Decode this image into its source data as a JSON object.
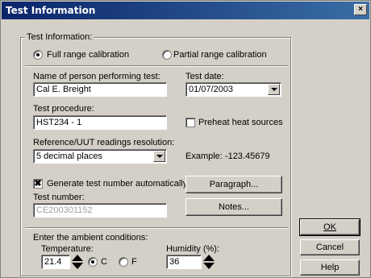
{
  "window": {
    "title": "Test Information",
    "close_glyph": "×"
  },
  "group": {
    "legend": "Test Information:"
  },
  "calibration": {
    "full_label": "Full range calibration",
    "partial_label": "Partial range calibration",
    "selected": "full"
  },
  "person": {
    "label": "Name of person performing test:",
    "value": "Cal E. Breight"
  },
  "test_date": {
    "label": "Test date:",
    "value": "01/07/2003"
  },
  "procedure": {
    "label": "Test procedure:",
    "value": "HST234 - 1"
  },
  "preheat": {
    "label": "Preheat heat sources",
    "checked": false
  },
  "resolution": {
    "label": "Reference/UUT readings resolution:",
    "value": "5 decimal places",
    "example": "Example: -123.45679"
  },
  "generate": {
    "label": "Generate test number automatically",
    "checked": true,
    "check_glyph": "✖"
  },
  "test_number": {
    "label": "Test number:",
    "value": "CE200301152"
  },
  "buttons": {
    "paragraph": "Paragraph...",
    "notes": "Notes...",
    "ok": "OK",
    "cancel": "Cancel",
    "help": "Help"
  },
  "ambient": {
    "label": "Enter the ambient conditions:",
    "temperature_label": "Temperature:",
    "temperature_value": "21.4",
    "unit_c": "C",
    "unit_f": "F",
    "unit_selected": "C",
    "humidity_label": "Humidity (%):",
    "humidity_value": "36"
  }
}
